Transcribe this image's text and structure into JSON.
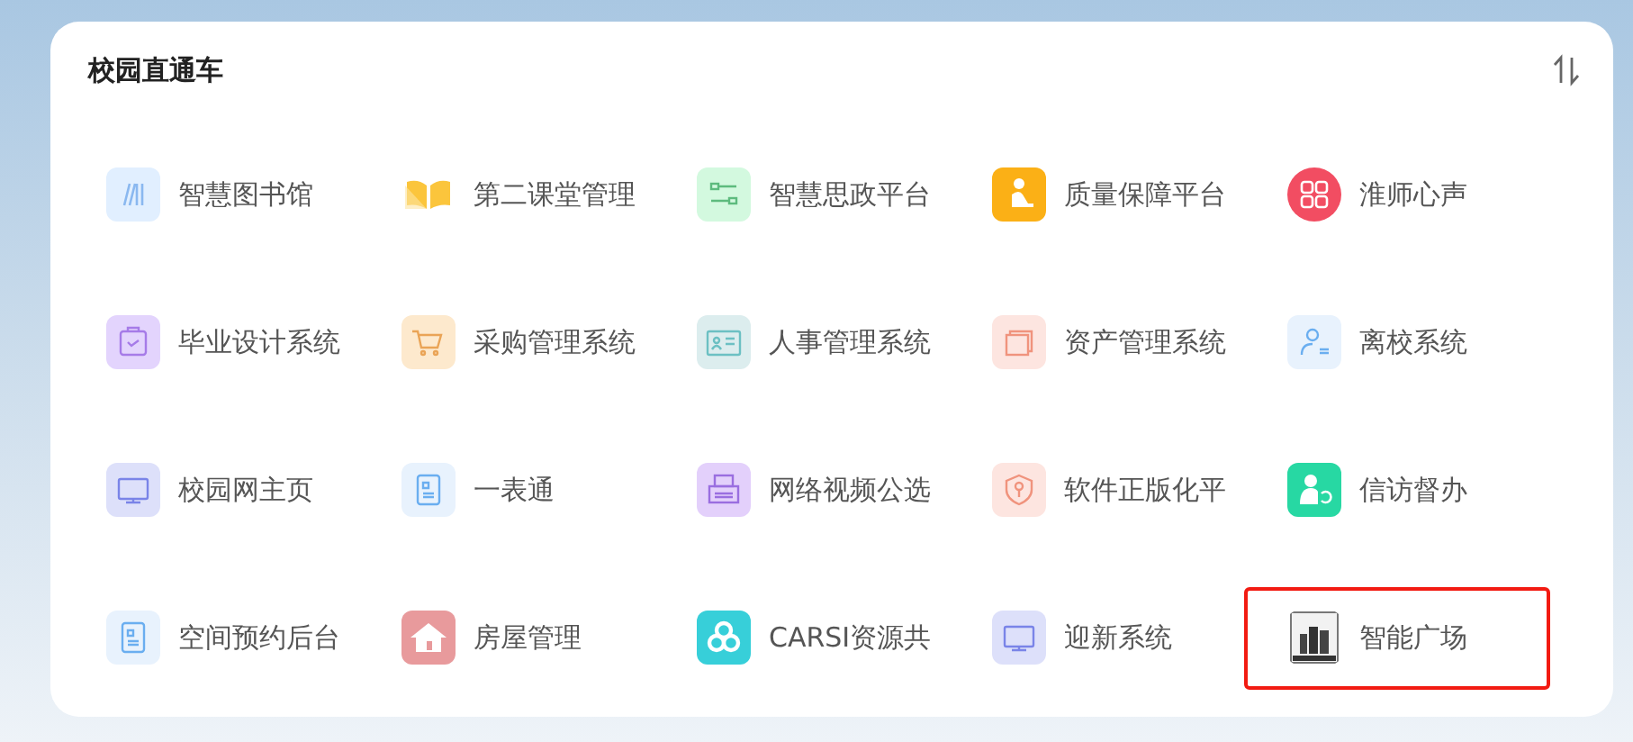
{
  "panel": {
    "title": "校园直通车"
  },
  "apps": [
    {
      "label": "智慧图书馆",
      "kind": "books",
      "highlighted": false
    },
    {
      "label": "第二课堂管理",
      "kind": "open-book",
      "highlighted": false
    },
    {
      "label": "智慧思政平台",
      "kind": "sliders",
      "highlighted": false
    },
    {
      "label": "质量保障平台",
      "kind": "person-desk",
      "highlighted": false
    },
    {
      "label": "淮师心声",
      "kind": "grid",
      "highlighted": false
    },
    {
      "label": "毕业设计系统",
      "kind": "clipboard",
      "highlighted": false
    },
    {
      "label": "采购管理系统",
      "kind": "cart",
      "highlighted": false
    },
    {
      "label": "人事管理系统",
      "kind": "id-card",
      "highlighted": false
    },
    {
      "label": "资产管理系统",
      "kind": "stack",
      "highlighted": false
    },
    {
      "label": "离校系统",
      "kind": "user-list",
      "highlighted": false
    },
    {
      "label": "校园网主页",
      "kind": "monitor",
      "highlighted": false
    },
    {
      "label": "一表通",
      "kind": "document",
      "highlighted": false
    },
    {
      "label": "网络视频公选",
      "kind": "printer",
      "highlighted": false
    },
    {
      "label": "软件正版化平",
      "kind": "shield",
      "highlighted": false
    },
    {
      "label": "信访督办",
      "kind": "person-refresh",
      "highlighted": false
    },
    {
      "label": "空间预约后台",
      "kind": "document",
      "highlighted": false
    },
    {
      "label": "房屋管理",
      "kind": "house",
      "highlighted": false
    },
    {
      "label": "CARSI资源共",
      "kind": "circles",
      "highlighted": false
    },
    {
      "label": "迎新系统",
      "kind": "monitor",
      "highlighted": false
    },
    {
      "label": "智能广场",
      "kind": "building",
      "highlighted": true
    }
  ]
}
